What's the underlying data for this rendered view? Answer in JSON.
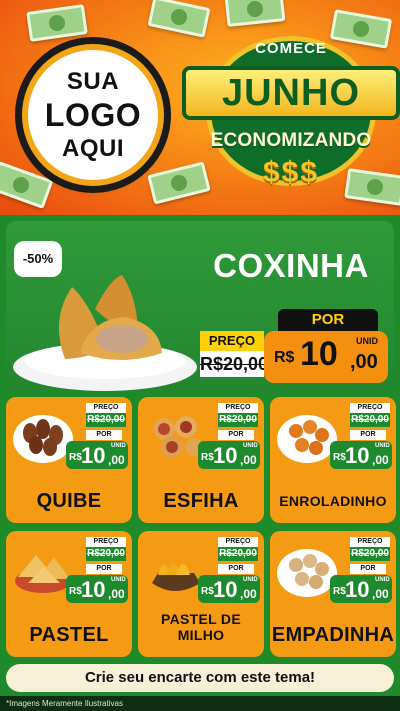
{
  "header": {
    "logo_lines": [
      "SUA",
      "LOGO",
      "AQUI"
    ],
    "promo_top": "COMECE",
    "promo_main": "JUNHO",
    "promo_bottom": "ECONOMIZANDO",
    "promo_symbols": "$$$"
  },
  "main_offer": {
    "discount": "-50%",
    "name": "COXINHA",
    "old_label": "PREÇO",
    "old_price": "R$20,00",
    "new_label": "POR",
    "currency": "R$",
    "price_int": "10",
    "price_dec": ",00",
    "unit": "UNID"
  },
  "products": [
    {
      "name": "QUIBE",
      "old_label": "PREÇO",
      "old_price": "R$20,00",
      "new_label": "POR",
      "currency": "R$",
      "price_int": "10",
      "price_dec": ",00",
      "unit": "UNID",
      "icon": "quibe-icon"
    },
    {
      "name": "ESFIHA",
      "old_label": "PREÇO",
      "old_price": "R$20,00",
      "new_label": "POR",
      "currency": "R$",
      "price_int": "10",
      "price_dec": ",00",
      "unit": "UNID",
      "icon": "esfiha-icon"
    },
    {
      "name": "ENROLADINHO",
      "old_label": "PREÇO",
      "old_price": "R$20,00",
      "new_label": "POR",
      "currency": "R$",
      "price_int": "10",
      "price_dec": ",00",
      "unit": "UNID",
      "icon": "enroladinho-icon"
    },
    {
      "name": "PASTEL",
      "old_label": "PREÇO",
      "old_price": "R$20,00",
      "new_label": "POR",
      "currency": "R$",
      "price_int": "10",
      "price_dec": ",00",
      "unit": "UNID",
      "icon": "pastel-icon"
    },
    {
      "name": "PASTEL DE MILHO",
      "old_label": "PREÇO",
      "old_price": "R$20,00",
      "new_label": "POR",
      "currency": "R$",
      "price_int": "10",
      "price_dec": ",00",
      "unit": "UNID",
      "icon": "pastel-de-milho-icon"
    },
    {
      "name": "EMPADINHA",
      "old_label": "PREÇO",
      "old_price": "R$20,00",
      "new_label": "POR",
      "currency": "R$",
      "price_int": "10",
      "price_dec": ",00",
      "unit": "UNID",
      "icon": "empadinha-icon"
    }
  ],
  "footer": {
    "cta": "Crie seu encarte com este tema!",
    "disclaimer": "*Imagens Meramente Ilustrativas"
  },
  "colors": {
    "orange": "#f59a13",
    "green": "#1d8a2d",
    "yellow": "#ffd10b"
  }
}
